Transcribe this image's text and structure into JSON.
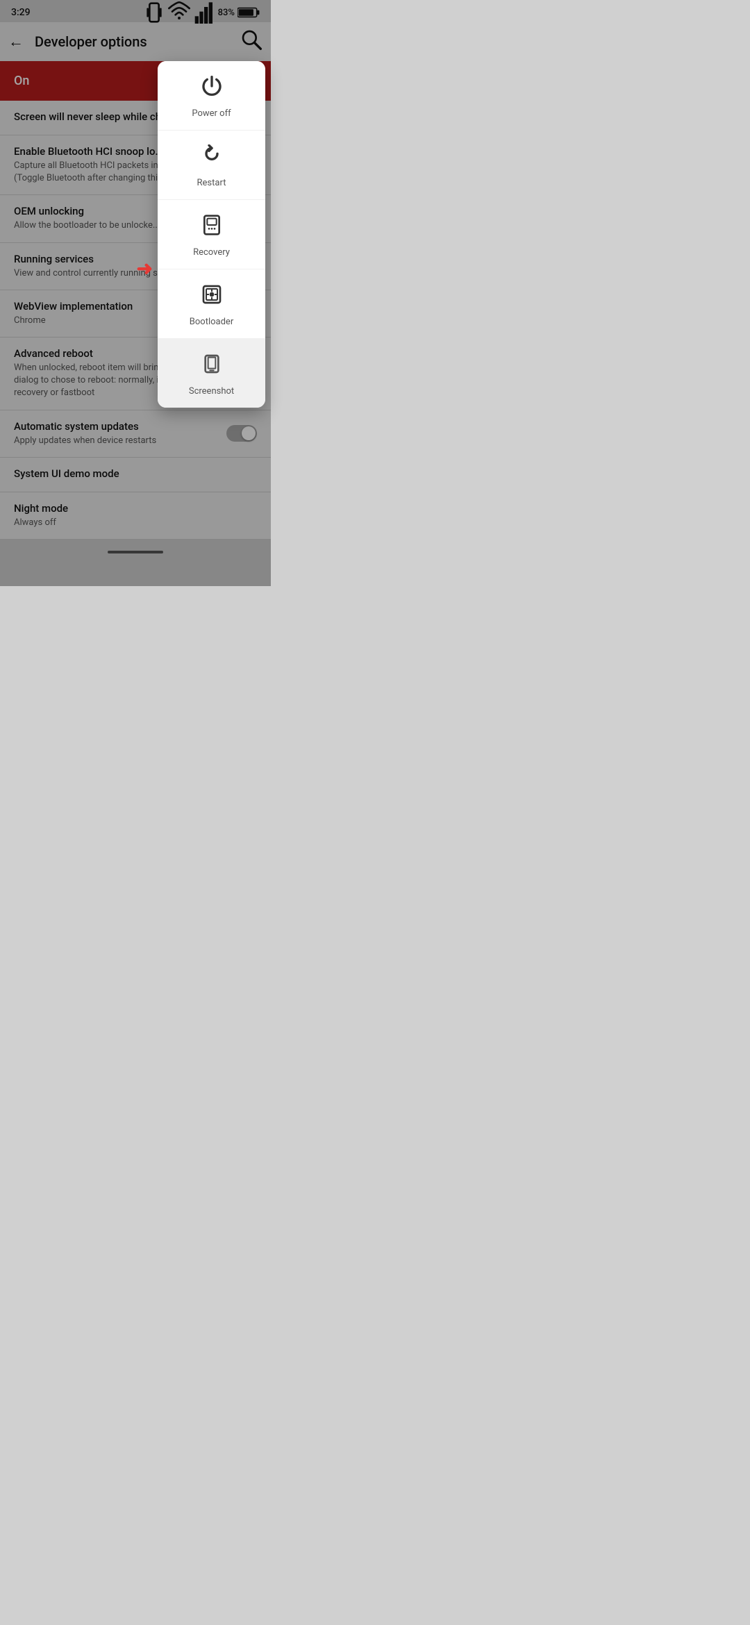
{
  "statusBar": {
    "time": "3:29",
    "battery": "83%"
  },
  "appBar": {
    "title": "Developer options",
    "backIcon": "←",
    "searchIcon": "🔍"
  },
  "onBanner": {
    "label": "On"
  },
  "settingsItems": [
    {
      "title": "Screen will never sleep while charg...",
      "subtitle": ""
    },
    {
      "title": "Enable Bluetooth HCI snoop lo...",
      "subtitle": "Capture all Bluetooth HCI packets in a...\n(Toggle Bluetooth after changing this s..."
    },
    {
      "title": "OEM unlocking",
      "subtitle": "Allow the bootloader to be unlocke..."
    },
    {
      "title": "Running services",
      "subtitle": "View and control currently running ser..."
    },
    {
      "title": "WebView implementation",
      "subtitle": "Chrome"
    },
    {
      "title": "Advanced reboot",
      "subtitle": "When unlocked, reboot item will bring y...\ndialog to chose to reboot: normally, into\nrecovery or fastboot"
    },
    {
      "title": "Automatic system updates",
      "subtitle": "Apply updates when device restarts",
      "hasToggle": true,
      "toggleOn": false
    },
    {
      "title": "System UI demo mode",
      "subtitle": ""
    },
    {
      "title": "Night mode",
      "subtitle": "Always off"
    }
  ],
  "powerMenu": {
    "items": [
      {
        "id": "power-off",
        "label": "Power off"
      },
      {
        "id": "restart",
        "label": "Restart"
      },
      {
        "id": "recovery",
        "label": "Recovery"
      },
      {
        "id": "bootloader",
        "label": "Bootloader"
      },
      {
        "id": "screenshot",
        "label": "Screenshot"
      }
    ]
  }
}
